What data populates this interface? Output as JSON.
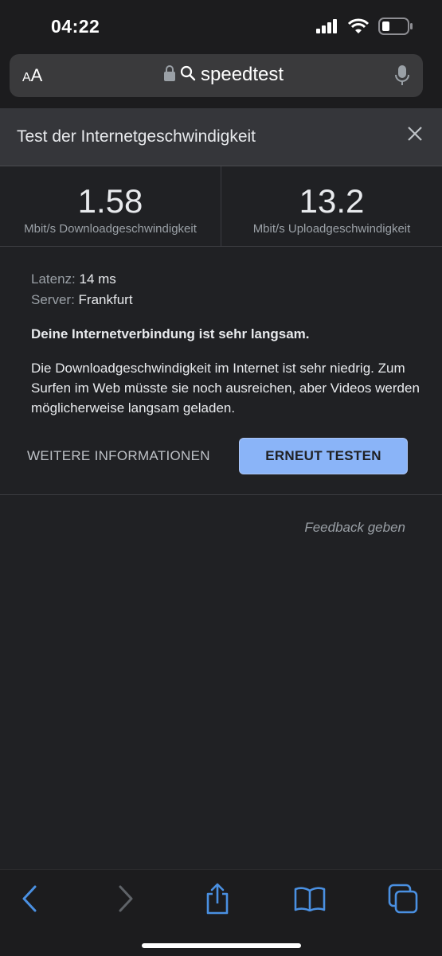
{
  "status_bar": {
    "time": "04:22",
    "icons": [
      "signal-icon",
      "wifi-icon",
      "battery-icon"
    ]
  },
  "browser": {
    "text_size_label_small": "A",
    "text_size_label_large": "A",
    "url": "speedtest",
    "icons": [
      "lock-icon",
      "search-icon",
      "microphone-icon"
    ]
  },
  "widget": {
    "title": "Test der Internetgeschwindigkeit",
    "download": {
      "value": "1.58",
      "label": "Mbit/s Downloadgeschwindigkeit"
    },
    "upload": {
      "value": "13.2",
      "label": "Mbit/s Uploadgeschwindigkeit"
    },
    "latency_key": "Latenz:",
    "latency_value": "14 ms",
    "server_key": "Server:",
    "server_value": "Frankfurt",
    "headline": "Deine Internetverbindung ist sehr langsam.",
    "description": "Die Downloadgeschwindigkeit im Internet ist sehr niedrig. Zum Surfen im Web müsste sie noch ausreichen, aber Videos werden möglicherweise langsam geladen.",
    "more_info_label": "WEITERE INFORMATIONEN",
    "retest_label": "ERNEUT TESTEN",
    "feedback_label": "Feedback geben"
  },
  "toolbar": {
    "icons": [
      "back-icon",
      "forward-icon",
      "share-icon",
      "bookmarks-icon",
      "tabs-icon"
    ]
  },
  "colors": {
    "accent": "#8ab4f8",
    "toolbar_icon": "#4a90e2",
    "background": "#202124",
    "header": "#35363a"
  }
}
